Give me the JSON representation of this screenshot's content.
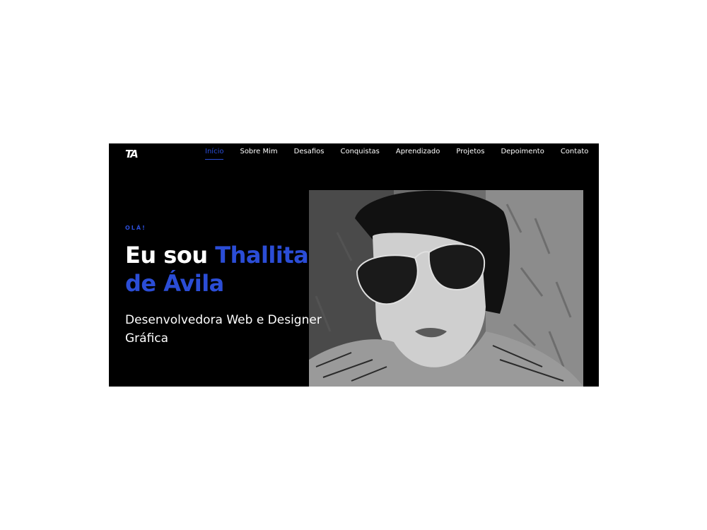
{
  "header": {
    "logo_text": "TA",
    "nav": [
      {
        "label": "Início",
        "active": true
      },
      {
        "label": "Sobre Mim",
        "active": false
      },
      {
        "label": "Desafios",
        "active": false
      },
      {
        "label": "Conquistas",
        "active": false
      },
      {
        "label": "Aprendizado",
        "active": false
      },
      {
        "label": "Projetos",
        "active": false
      },
      {
        "label": "Depoimento",
        "active": false
      },
      {
        "label": "Contato",
        "active": false
      }
    ]
  },
  "hero": {
    "greeting": "OLÁ!",
    "headline_prefix": "Eu sou ",
    "headline_name": "Thallita de Ávila",
    "subtitle": "Desenvolvedora Web e Designer Gráfica"
  },
  "colors": {
    "accent": "#2b4dd6",
    "background": "#000000",
    "text": "#ffffff"
  }
}
